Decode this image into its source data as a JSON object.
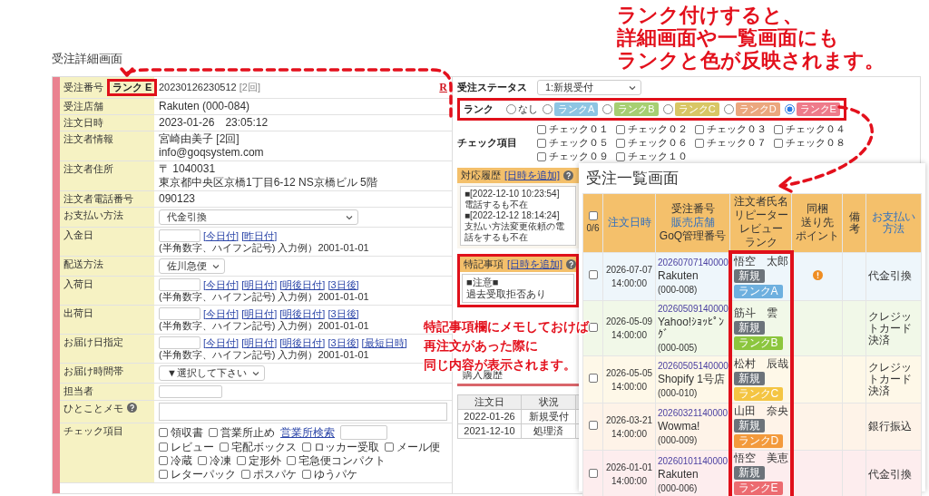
{
  "page_title": "受注詳細画面",
  "detail": {
    "order": {
      "label": "受注番号",
      "rank": "ランク E",
      "number": "20230126230512",
      "count": "[2回]",
      "shop_mark": "R"
    },
    "fields": [
      {
        "kind": "text",
        "label": "受注店舗",
        "lines": [
          "Rakuten (000-084)"
        ]
      },
      {
        "kind": "text",
        "label": "注文日時",
        "lines": [
          "2023-01-26　23:05:12"
        ]
      },
      {
        "kind": "text",
        "label": "注文者情報",
        "lines": [
          "宮崎由美子 [2回]",
          "info@goqsystem.com"
        ]
      },
      {
        "kind": "text",
        "label": "注文者住所",
        "lines": [
          "〒 1040031",
          "東京都中央区京橋1丁目6-12 NS京橋ビル 5階"
        ]
      },
      {
        "kind": "text",
        "label": "注文者電話番号",
        "lines": [
          "090123"
        ]
      },
      {
        "kind": "select",
        "label": "お支払い方法",
        "value": "代金引換",
        "wide": true
      },
      {
        "kind": "date",
        "label": "入金日",
        "links": [
          "[今日付]",
          "[昨日付]"
        ],
        "hint": "(半角数字、ハイフン記号) 入力例）2001-01-01"
      },
      {
        "kind": "select",
        "label": "配送方法",
        "value": "佐川急便",
        "wide": false
      },
      {
        "kind": "date",
        "label": "入荷日",
        "links": [
          "[今日付]",
          "[明日付]",
          "[明後日付]",
          "[3日後]"
        ],
        "hint": "(半角数字、ハイフン記号) 入力例）2001-01-01"
      },
      {
        "kind": "date",
        "label": "出荷日",
        "links": [
          "[今日付]",
          "[明日付]",
          "[明後日付]",
          "[3日後]"
        ],
        "hint": "(半角数字、ハイフン記号) 入力例）2001-01-01"
      },
      {
        "kind": "date",
        "label": "お届け日指定",
        "links": [
          "[今日付]",
          "[明日付]",
          "[明後日付]",
          "[3日後]",
          "[最短日時]"
        ],
        "hint": "(半角数字、ハイフン記号) 入力例）2001-01-01"
      },
      {
        "kind": "select",
        "label": "お届け時間帯",
        "value": "▼選択して下さい",
        "wide": false
      },
      {
        "kind": "input",
        "label": "担当者"
      },
      {
        "kind": "memo",
        "label": "ひとことメモ",
        "help": true
      },
      {
        "kind": "checks",
        "label": "チェック項目",
        "items": [
          {
            "kind": "check",
            "label": "領収書",
            "checked": false
          },
          {
            "kind": "check",
            "label": "営業所止め",
            "checked": false
          },
          {
            "kind": "link",
            "label": "営業所検索"
          },
          {
            "kind": "input"
          },
          {
            "kind": "check",
            "label": "レビュー",
            "checked": false
          },
          {
            "kind": "check",
            "label": "宅配ボックス",
            "checked": false
          },
          {
            "kind": "check",
            "label": "ロッカー受取",
            "checked": false
          },
          {
            "kind": "check",
            "label": "メール便",
            "checked": false
          },
          {
            "kind": "check",
            "label": "冷蔵",
            "checked": false
          },
          {
            "kind": "check",
            "label": "冷凍",
            "checked": false
          },
          {
            "kind": "check",
            "label": "定形外",
            "checked": false
          },
          {
            "kind": "check",
            "label": "宅急便コンパクト",
            "checked": false
          },
          {
            "kind": "check",
            "label": "レターパック",
            "checked": false
          },
          {
            "kind": "check",
            "label": "ポスパケ",
            "checked": false
          },
          {
            "kind": "check",
            "label": "ゆうパケ",
            "checked": false
          }
        ]
      }
    ]
  },
  "side": {
    "status": {
      "label": "受注ステータス",
      "value": "1:新規受付"
    },
    "rank": {
      "label": "ランク",
      "options": [
        {
          "label": "なし",
          "selected": false
        },
        {
          "label": "ランクA",
          "color": "#8ec5e3",
          "selected": false
        },
        {
          "label": "ランクB",
          "color": "#a6cf72",
          "selected": false
        },
        {
          "label": "ランクC",
          "color": "#d8c665",
          "selected": false
        },
        {
          "label": "ランクD",
          "color": "#eba77e",
          "selected": false
        },
        {
          "label": "ランクE",
          "color": "#ee7b8a",
          "selected": true
        }
      ]
    },
    "checks": {
      "label": "チェック項目",
      "items": [
        {
          "label": "チェック０１",
          "checked": false
        },
        {
          "label": "チェック０２",
          "checked": false
        },
        {
          "label": "チェック０３",
          "checked": false
        },
        {
          "label": "チェック０４",
          "checked": false
        },
        {
          "label": "チェック０５",
          "checked": false
        },
        {
          "label": "チェック０６",
          "checked": false
        },
        {
          "label": "チェック０７",
          "checked": false
        },
        {
          "label": "チェック０８",
          "checked": false
        },
        {
          "label": "チェック０９",
          "checked": false
        },
        {
          "label": "チェック１０",
          "checked": false
        }
      ]
    },
    "history": {
      "title": "対応履歴",
      "link": "[日時を追加]",
      "help": true,
      "lines": [
        "■[2022-12-10 10:23:54]",
        "電話するも不在",
        "■[2022-12-12 18:14:24]",
        "支払い方法変更依頼の電話をするも不在"
      ]
    },
    "notes": {
      "title": "特記事項",
      "link": "[日時を追加]",
      "help": true,
      "text": "■注意■ 過去受取拒否あり"
    },
    "purchases": {
      "title": "購入履歴",
      "columns": [
        "注文日",
        "状況"
      ],
      "rows": [
        [
          "2022-01-26",
          "新規受付"
        ],
        [
          "2021-12-10",
          "処理済"
        ]
      ]
    }
  },
  "list": {
    "title": "受注一覧画面",
    "header": {
      "checked": false,
      "count": "0/6",
      "date": "注文日時",
      "order": [
        "受注番号",
        "販売店舗",
        "GoQ管理番号"
      ],
      "customer": [
        "注文者氏名",
        "リピーター",
        "レビュー",
        "ランク"
      ],
      "bundle": [
        "同梱",
        "送り先",
        "ポイント"
      ],
      "memo": "備考",
      "payment": "お支払い方法"
    },
    "rows": [
      {
        "selected": false,
        "date": "2026-07-07",
        "time": "14:00:00",
        "order": "20260707140000",
        "shop": "Rakuten",
        "code": "(000-008)",
        "customer": "悟空　太郎",
        "repeat": "新規",
        "rank": "ランクA",
        "color": "#6eb0df",
        "alert": true,
        "payment": "代金引換"
      },
      {
        "selected": false,
        "date": "2026-05-09",
        "time": "14:00:00",
        "order": "20260509140000",
        "shop": "Yahoo!ｼｮｯﾋﾟﾝｸﾞ",
        "code": "(000-005)",
        "customer": "筋斗　雲",
        "repeat": "新規",
        "rank": "ランクB",
        "color": "#8cc63e",
        "alert": false,
        "payment": "クレジットカード決済"
      },
      {
        "selected": false,
        "date": "2026-05-05",
        "time": "14:00:00",
        "order": "20260505140000",
        "shop": "Shopify 1号店",
        "code": "(000-010)",
        "customer": "松村　辰哉",
        "repeat": "新規",
        "rank": "ランクC",
        "color": "#f4c543",
        "alert": false,
        "payment": "クレジットカード決済"
      },
      {
        "selected": false,
        "date": "2026-03-21",
        "time": "14:00:00",
        "order": "20260321140000",
        "shop": "Wowma!",
        "code": "(000-009)",
        "customer": "山田　奈央",
        "repeat": "新規",
        "rank": "ランクD",
        "color": "#f39a3c",
        "alert": false,
        "payment": "銀行振込"
      },
      {
        "selected": false,
        "date": "2026-01-01",
        "time": "14:00:00",
        "order": "20260101140000",
        "shop": "Rakuten",
        "code": "(000-006)",
        "customer": "悟空　美恵",
        "repeat": "新規",
        "rank": "ランクE",
        "color": "#ec6b70",
        "alert": false,
        "payment": "代金引換"
      }
    ]
  },
  "callouts": [
    {
      "lines": [
        "ランク付けすると、",
        "詳細画面や一覧画面にも",
        "ランクと色が反映されます。"
      ]
    },
    {
      "lines": [
        "特記事項欄にメモしておけば",
        "再注文があった際に",
        "同じ内容が表示されます。"
      ]
    }
  ]
}
